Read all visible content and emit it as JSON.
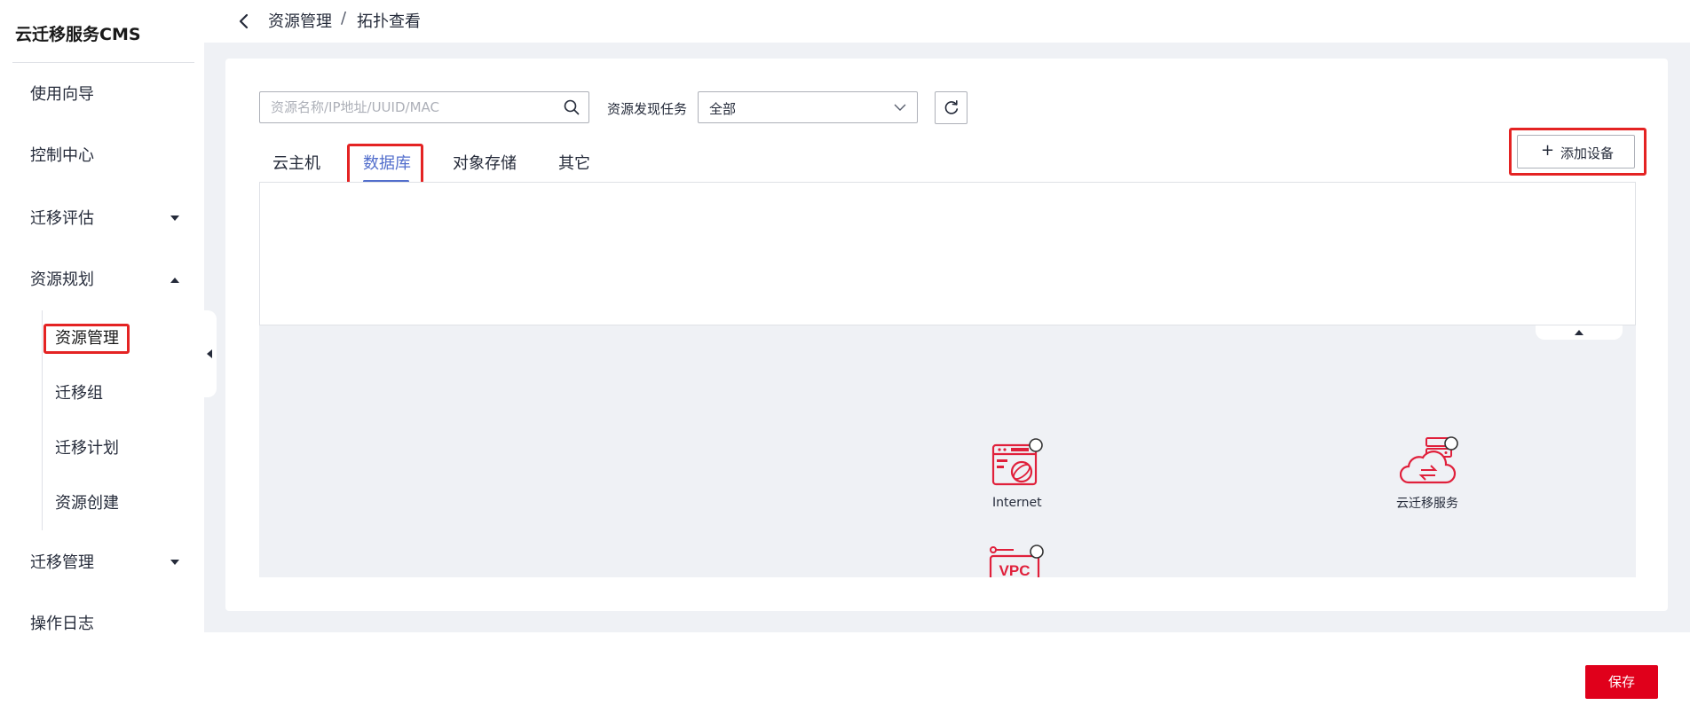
{
  "sidebar": {
    "title": "云迁移服务CMS",
    "items": [
      {
        "label": "使用向导"
      },
      {
        "label": "控制中心"
      },
      {
        "label": "迁移评估"
      },
      {
        "label": "资源规划"
      },
      {
        "label": "迁移管理"
      },
      {
        "label": "操作日志"
      }
    ],
    "sub_items": [
      {
        "label": "资源管理"
      },
      {
        "label": "迁移组"
      },
      {
        "label": "迁移计划"
      },
      {
        "label": "资源创建"
      }
    ]
  },
  "breadcrumb": {
    "parent": "资源管理",
    "separator": "/",
    "current": "拓扑查看"
  },
  "filters": {
    "search_placeholder": "资源名称/IP地址/UUID/MAC",
    "task_label": "资源发现任务",
    "task_value": "全部"
  },
  "tabs": [
    {
      "label": "云主机"
    },
    {
      "label": "数据库"
    },
    {
      "label": "对象存储"
    },
    {
      "label": "其它"
    }
  ],
  "add_device_label": "添加设备",
  "topology": {
    "nodes": [
      {
        "label": "Internet"
      },
      {
        "label": "云迁移服务"
      },
      {
        "label": "VPC"
      }
    ]
  },
  "save_label": "保存",
  "colors": {
    "accent": "#526ecc",
    "highlight": "#e42323",
    "brand_red": "#e0001b",
    "icon_red": "#e0203b"
  }
}
